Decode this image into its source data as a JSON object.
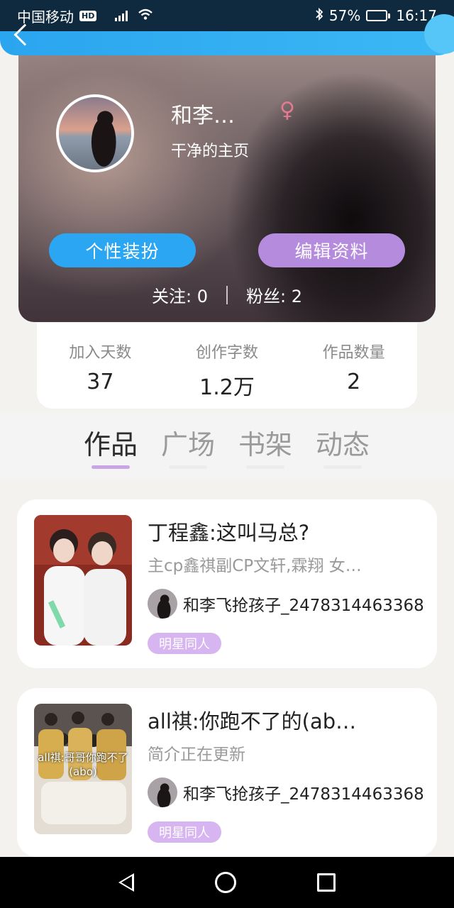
{
  "status_bar": {
    "carrier": "中国移动",
    "hd_badge": "HD",
    "battery_text": "57%",
    "battery_level": 0.57,
    "time": "16:17"
  },
  "profile": {
    "name": "和李…",
    "gender_symbol": "♀",
    "subtitle": "干净的主页",
    "style_button": "个性装扮",
    "edit_button": "编辑资料",
    "following_label": "关注:",
    "following_count": "0",
    "followers_label": "粉丝:",
    "followers_count": "2"
  },
  "stats": [
    {
      "label": "加入天数",
      "value": "37"
    },
    {
      "label": "创作字数",
      "value": "1.2万"
    },
    {
      "label": "作品数量",
      "value": "2"
    }
  ],
  "tabs": [
    {
      "label": "作品",
      "active": true
    },
    {
      "label": "广场",
      "active": false
    },
    {
      "label": "书架",
      "active": false
    },
    {
      "label": "动态",
      "active": false
    }
  ],
  "works": [
    {
      "title": "丁程鑫:这叫马总?",
      "description": "主cp鑫祺副CP文轩,霖翔 女…",
      "author": "和李飞抢孩子_2478314463368",
      "tag": "明星同人"
    },
    {
      "title": "all祺:你跑不了的(ab…",
      "description": "简介正在更新",
      "author": "和李飞抢孩子_2478314463368",
      "tag": "明星同人",
      "cover_text": "all祺:哥哥你跑不了(abo)"
    }
  ],
  "colors": {
    "accent_blue": "#2aa6f2",
    "accent_purple": "#b58bde",
    "tag_purple": "#d7b5f0",
    "female_pink": "#e47a91"
  },
  "icons": {
    "back": "chevron-left-icon",
    "gender": "female-icon",
    "nav_back": "triangle-back-icon",
    "nav_home": "circle-home-icon",
    "nav_recent": "square-recent-icon"
  }
}
